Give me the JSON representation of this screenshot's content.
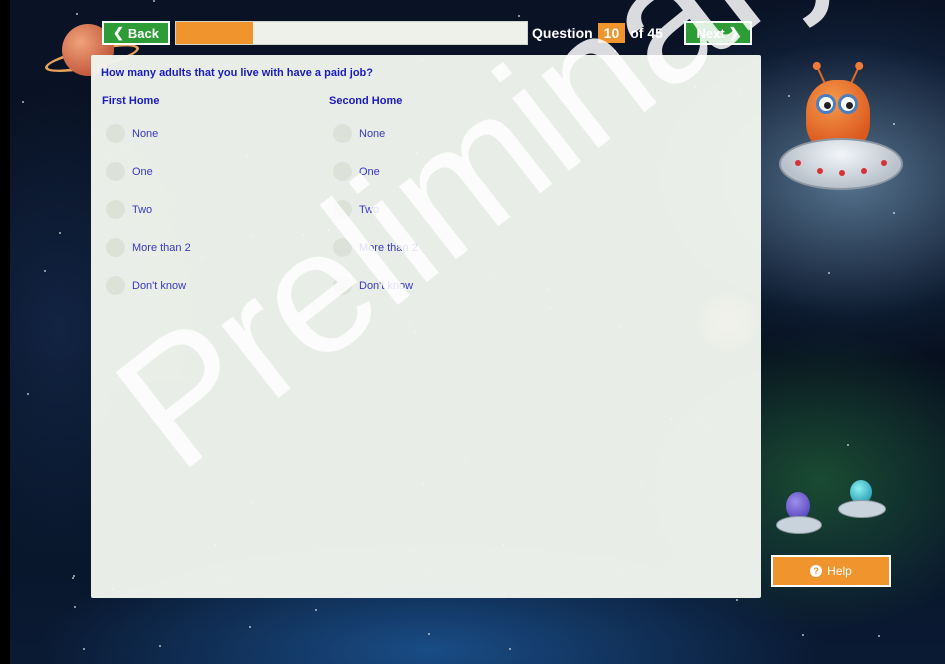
{
  "nav": {
    "back_label": "Back",
    "next_label": "Next",
    "question_prefix": "Question",
    "question_current": "10",
    "question_total_text": "of 45",
    "progress_fraction": 0.22
  },
  "question": {
    "text": "How many adults that you live with have a paid job?",
    "columns": [
      {
        "title": "First Home",
        "options": [
          "None",
          "One",
          "Two",
          "More than 2",
          "Don't know"
        ]
      },
      {
        "title": "Second Home",
        "options": [
          "None",
          "One",
          "Two",
          "More than 2",
          "Don't know"
        ]
      }
    ]
  },
  "help": {
    "label": "Help"
  },
  "watermark": "Preliminary",
  "colors": {
    "accent_green": "#2d9b36",
    "accent_orange": "#f0952e",
    "question_blue": "#1b1bc4"
  }
}
